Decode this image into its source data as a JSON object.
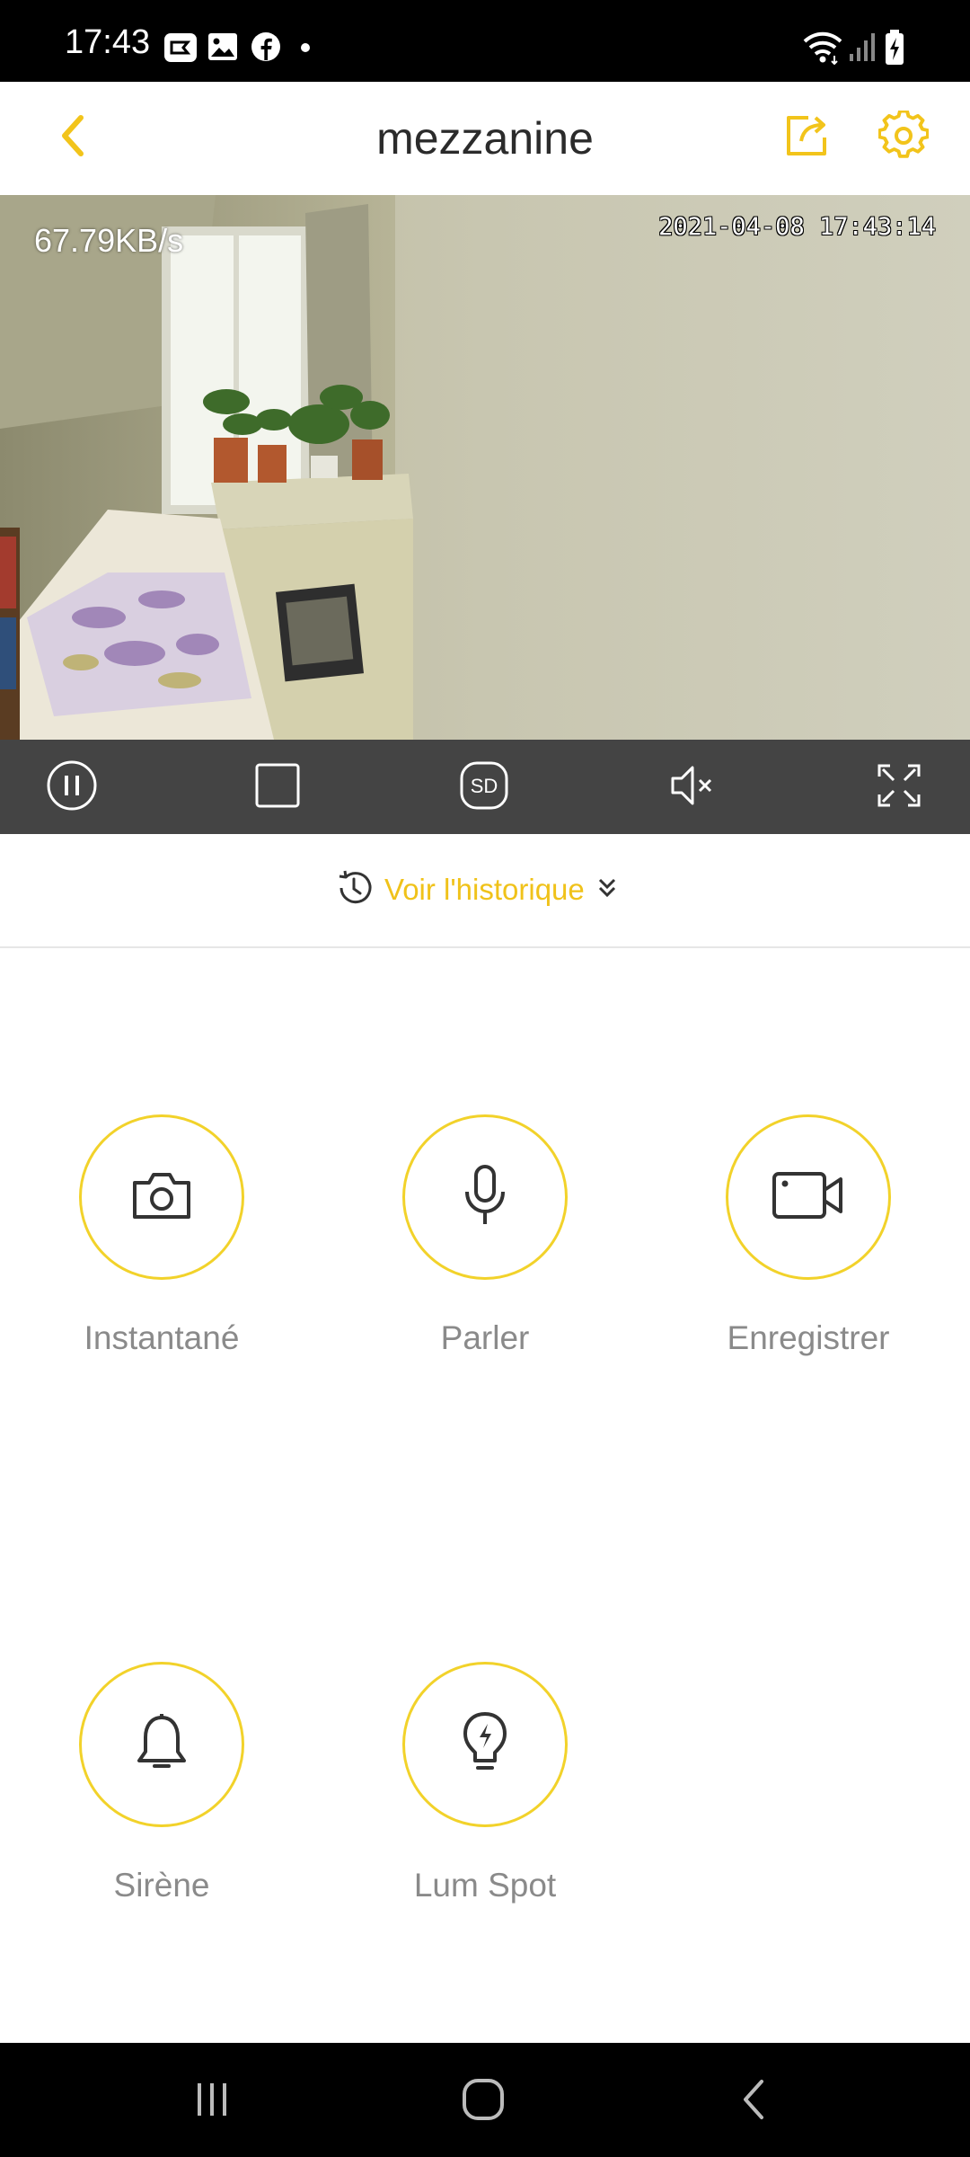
{
  "status_bar": {
    "time": "17:43",
    "notification_icons": [
      "cast-app-icon",
      "gallery-icon",
      "facebook-icon",
      "dot-icon"
    ],
    "right_icons": [
      "wifi-icon",
      "cell-signal-icon",
      "battery-charging-icon"
    ]
  },
  "header": {
    "title": "mezzanine",
    "back_icon": "chevron-left-icon",
    "share_icon": "share-icon",
    "settings_icon": "gear-icon",
    "accent_color": "#f2c41b"
  },
  "video": {
    "bitrate": "67.79KB/s",
    "timestamp": "2021-04-08 17:43:14"
  },
  "controls": {
    "items": [
      "pause-icon",
      "stop-icon",
      "sd-quality-icon",
      "mute-icon",
      "fullscreen-icon"
    ],
    "sd_label": "SD"
  },
  "history": {
    "label": "Voir l'historique"
  },
  "actions": [
    {
      "label": "Instantané",
      "icon": "camera-icon"
    },
    {
      "label": "Parler",
      "icon": "microphone-icon"
    },
    {
      "label": "Enregistrer",
      "icon": "video-camera-icon"
    },
    {
      "label": "Sirène",
      "icon": "bell-icon"
    },
    {
      "label": "Lum Spot",
      "icon": "lightbulb-icon"
    }
  ],
  "nav_bar": {
    "items": [
      "recent-apps-icon",
      "home-icon",
      "back-icon"
    ]
  }
}
